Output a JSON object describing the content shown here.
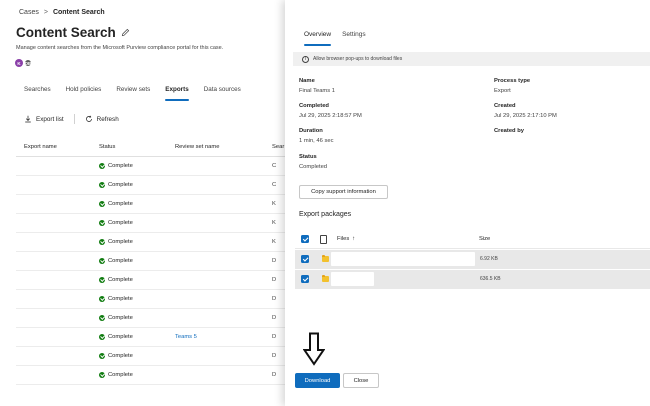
{
  "breadcrumb": {
    "parent": "Cases",
    "separator": ">",
    "current": "Content Search"
  },
  "page": {
    "title": "Content Search",
    "subtitle": "Manage content searches from the Microsoft Purview compliance portal for this case.",
    "avatars": [
      "K",
      "DB"
    ]
  },
  "tabs": [
    "Searches",
    "Hold policies",
    "Review sets",
    "Exports",
    "Data sources"
  ],
  "toolbar": {
    "export_list": "Export list",
    "refresh": "Refresh"
  },
  "grid": {
    "columns": [
      "Export name",
      "Status",
      "Review set name",
      "Sear"
    ],
    "rows": [
      {
        "status": "Complete",
        "review_set": "",
        "search": "C"
      },
      {
        "status": "Complete",
        "review_set": "",
        "search": "C"
      },
      {
        "status": "Complete",
        "review_set": "",
        "search": "K"
      },
      {
        "status": "Complete",
        "review_set": "",
        "search": "K"
      },
      {
        "status": "Complete",
        "review_set": "",
        "search": "K"
      },
      {
        "status": "Complete",
        "review_set": "",
        "search": "D"
      },
      {
        "status": "Complete",
        "review_set": "",
        "search": "D"
      },
      {
        "status": "Complete",
        "review_set": "",
        "search": "D"
      },
      {
        "status": "Complete",
        "review_set": "",
        "search": "D"
      },
      {
        "status": "Complete",
        "review_set": "Teams 5",
        "search": "D"
      },
      {
        "status": "Complete",
        "review_set": "",
        "search": "D"
      },
      {
        "status": "Complete",
        "review_set": "",
        "search": "D"
      }
    ]
  },
  "panel": {
    "tabs": [
      "Overview",
      "Settings"
    ],
    "message": "Allow browser pop-ups to download files",
    "fields": {
      "name_label": "Name",
      "name_value": "Final Teams 1",
      "process_type_label": "Process type",
      "process_type_value": "Export",
      "completed_label": "Completed",
      "completed_value": "Jul 29, 2025 2:18:57 PM",
      "created_label": "Created",
      "created_value": "Jul 29, 2025 2:17:10 PM",
      "duration_label": "Duration",
      "duration_value": "1 min, 46 sec",
      "created_by_label": "Created by",
      "status_label": "Status",
      "status_value": "Completed"
    },
    "copy_button": "Copy support information",
    "packages_title": "Export packages",
    "packages": {
      "files_header": "Files",
      "sort_indicator": "↑",
      "size_header": "Size",
      "rows": [
        {
          "size": "6.92 KB"
        },
        {
          "size": "636.5 KB"
        }
      ]
    },
    "download_button": "Download",
    "close_button": "Close"
  },
  "colors": {
    "accent": "#0f6cbd",
    "success": "#107c10"
  },
  "icons": [
    "pencil-icon",
    "download-icon",
    "refresh-icon",
    "info-icon",
    "document-icon",
    "folder-icon",
    "arrow-down-icon"
  ]
}
